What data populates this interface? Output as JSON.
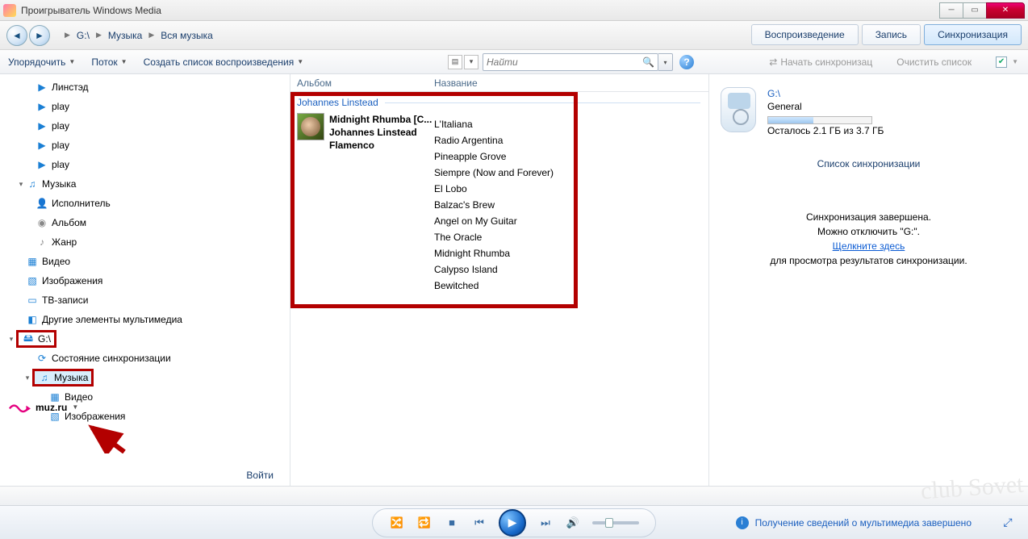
{
  "window": {
    "title": "Проигрыватель Windows Media"
  },
  "breadcrumb": {
    "p1": "G:\\",
    "p2": "Музыка",
    "p3": "Вся музыка"
  },
  "tabs": {
    "play": "Воспроизведение",
    "burn": "Запись",
    "sync": "Синхронизация"
  },
  "toolbar": {
    "organize": "Упорядочить",
    "stream": "Поток",
    "create_playlist": "Создать список воспроизведения",
    "search_placeholder": "Найти",
    "sync_start": "Начать синхронизац",
    "sync_clear": "Очистить список"
  },
  "sidebar": {
    "items": [
      {
        "label": "Линстэд",
        "icon": "playlist"
      },
      {
        "label": "play",
        "icon": "playlist"
      },
      {
        "label": "play",
        "icon": "playlist"
      },
      {
        "label": "play",
        "icon": "playlist"
      },
      {
        "label": "play",
        "icon": "playlist"
      }
    ],
    "music": "Музыка",
    "artist": "Исполнитель",
    "album": "Альбом",
    "genre": "Жанр",
    "video": "Видео",
    "images": "Изображения",
    "tv": "ТВ-записи",
    "other": "Другие элементы мультимедиа",
    "drive": "G:\\",
    "sync_state": "Состояние синхронизации",
    "drive_music": "Музыка",
    "drive_video": "Видео",
    "drive_images": "Изображения",
    "login": "Войти",
    "muz": "muz.ru"
  },
  "columns": {
    "album": "Альбом",
    "title": "Название"
  },
  "artist_header": "Johannes Linstead",
  "album": {
    "name": "Midnight Rhumba [C...",
    "artist": "Johannes Linstead",
    "genre": "Flamenco"
  },
  "songs": [
    "L'Italiana",
    "Radio Argentina",
    "Pineapple Grove",
    "Siempre (Now and Forever)",
    "El Lobo",
    "Balzac's Brew",
    "Angel on My Guitar",
    "The Oracle",
    "Midnight Rhumba",
    "Calypso Island",
    "Bewitched"
  ],
  "sync": {
    "drive": "G:\\",
    "label": "General",
    "space": "Осталось 2.1 ГБ из 3.7 ГБ",
    "list_title": "Список синхронизации",
    "done": "Синхронизация завершена.",
    "eject": "Можно отключить \"G:\".",
    "link": "Щелкните здесь",
    "after": "для просмотра результатов синхронизации."
  },
  "player": {
    "status": "Получение сведений о мультимедиа завершено"
  },
  "watermark": "club Sovet"
}
